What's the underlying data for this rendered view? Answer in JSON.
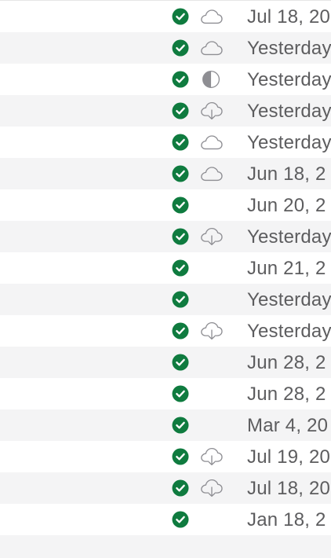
{
  "colors": {
    "synced_green": "#0f7b3f",
    "cloud_gray": "#8e8e93",
    "date_text": "#5d5d5f",
    "stripe": "#f4f4f5"
  },
  "rows": [
    {
      "status_icon": "checkmark-circle-icon",
      "cloud_icon": "cloud-icon",
      "date": "Jul 18, 20"
    },
    {
      "status_icon": "checkmark-circle-icon",
      "cloud_icon": "cloud-icon",
      "date": "Yesterday"
    },
    {
      "status_icon": "checkmark-circle-icon",
      "cloud_icon": "half-circle-icon",
      "date": "Yesterday"
    },
    {
      "status_icon": "checkmark-circle-icon",
      "cloud_icon": "cloud-download-icon",
      "date": "Yesterday"
    },
    {
      "status_icon": "checkmark-circle-icon",
      "cloud_icon": "cloud-icon",
      "date": "Yesterday"
    },
    {
      "status_icon": "checkmark-circle-icon",
      "cloud_icon": "cloud-icon",
      "date": "Jun 18, 2"
    },
    {
      "status_icon": "checkmark-circle-icon",
      "cloud_icon": "",
      "date": "Jun 20, 2"
    },
    {
      "status_icon": "checkmark-circle-icon",
      "cloud_icon": "cloud-download-icon",
      "date": "Yesterday"
    },
    {
      "status_icon": "checkmark-circle-icon",
      "cloud_icon": "",
      "date": "Jun 21, 2"
    },
    {
      "status_icon": "checkmark-circle-icon",
      "cloud_icon": "",
      "date": "Yesterday"
    },
    {
      "status_icon": "checkmark-circle-icon",
      "cloud_icon": "cloud-download-icon",
      "date": "Yesterday"
    },
    {
      "status_icon": "checkmark-circle-icon",
      "cloud_icon": "",
      "date": "Jun 28, 2"
    },
    {
      "status_icon": "checkmark-circle-icon",
      "cloud_icon": "",
      "date": "Jun 28, 2"
    },
    {
      "status_icon": "checkmark-circle-icon",
      "cloud_icon": "",
      "date": "Mar 4, 20"
    },
    {
      "status_icon": "checkmark-circle-icon",
      "cloud_icon": "cloud-download-icon",
      "date": "Jul 19, 20"
    },
    {
      "status_icon": "checkmark-circle-icon",
      "cloud_icon": "cloud-download-icon",
      "date": "Jul 18, 20"
    },
    {
      "status_icon": "checkmark-circle-icon",
      "cloud_icon": "",
      "date": "Jan 18, 2"
    },
    {
      "status_icon": "",
      "cloud_icon": "",
      "date": ""
    }
  ]
}
